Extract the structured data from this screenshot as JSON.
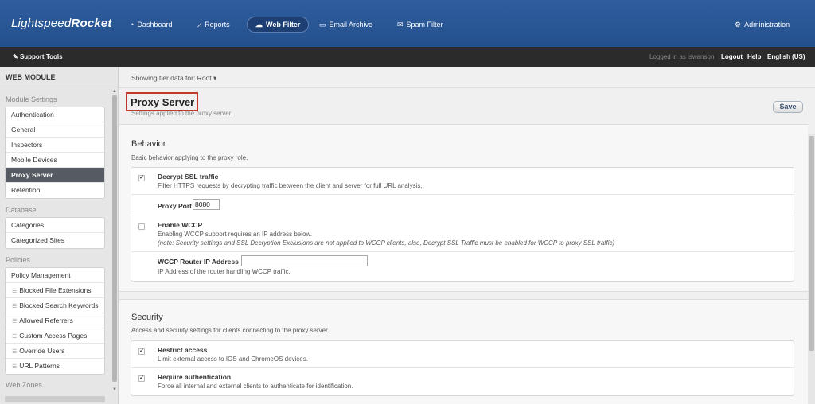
{
  "app": {
    "brand_light": "Lightspeed",
    "brand_bold": "Rocket"
  },
  "nav": {
    "items": [
      {
        "label": "Dashboard",
        "icon": "dashboard-icon",
        "glyph": "◔"
      },
      {
        "label": "Reports",
        "icon": "reports-icon",
        "glyph": "⩘"
      },
      {
        "label": "Web Filter",
        "icon": "web-filter-icon",
        "glyph": "☁",
        "active": true
      },
      {
        "label": "Email Archive",
        "icon": "email-archive-icon",
        "glyph": "▭"
      },
      {
        "label": "Spam Filter",
        "icon": "spam-filter-icon",
        "glyph": "✉"
      }
    ],
    "admin": {
      "label": "Administration",
      "icon": "gear-icon",
      "glyph": "⚙"
    }
  },
  "subbar": {
    "support_tools": "Support Tools",
    "logged_in": "Logged in as iswanson",
    "logout": "Logout",
    "help": "Help",
    "language": "English (US)"
  },
  "sidebar": {
    "module_title": "WEB MODULE",
    "sections": [
      {
        "title": "Module Settings",
        "items": [
          "Authentication",
          "General",
          "Inspectors",
          "Mobile Devices",
          "Proxy Server",
          "Retention"
        ],
        "active": "Proxy Server"
      },
      {
        "title": "Database",
        "items": [
          "Categories",
          "Categorized Sites"
        ]
      },
      {
        "title": "Policies",
        "items": [
          "Policy Management",
          "Blocked File Extensions",
          "Blocked Search Keywords",
          "Allowed Referrers",
          "Custom Access Pages",
          "Override Users",
          "URL Patterns"
        ]
      },
      {
        "title": "Web Zones",
        "items": []
      }
    ]
  },
  "main": {
    "tier_text": "Showing tier data for: Root ▾",
    "title": "Proxy Server",
    "subtitle": "Settings applied to the proxy server.",
    "save_label": "Save",
    "behavior": {
      "heading": "Behavior",
      "description": "Basic behavior applying to the proxy role.",
      "decrypt_ssl": {
        "label": "Decrypt SSL traffic",
        "desc": "Filter HTTPS requests by decrypting traffic between the client and server for full URL analysis.",
        "checked": true
      },
      "proxy_port": {
        "label": "Proxy Port",
        "value": "8080"
      },
      "wccp": {
        "label": "Enable WCCP",
        "desc": "Enabling WCCP support requires an IP address below.",
        "note": "(note: Security settings and SSL Decryption Exclusions are not applied to WCCP clients, also, Decrypt SSL Traffic must be enabled for WCCP to proxy SSL traffic)",
        "checked": false
      },
      "wccp_router": {
        "label": "WCCP Router IP Address",
        "value": "",
        "desc": "IP Address of the router handling WCCP traffic."
      }
    },
    "security": {
      "heading": "Security",
      "description": "Access and security settings for clients connecting to the proxy server.",
      "restrict_access": {
        "label": "Restrict access",
        "desc": "Limit external access to IOS and ChromeOS devices.",
        "checked": true
      },
      "require_auth": {
        "label": "Require authentication",
        "desc": "Force all internal and external clients to authenticate for identification.",
        "checked": true
      }
    }
  },
  "colors": {
    "header": "#2a5797",
    "subbar": "#2b2b2b",
    "active_item": "#565b63",
    "highlight_box": "#c0392b"
  }
}
